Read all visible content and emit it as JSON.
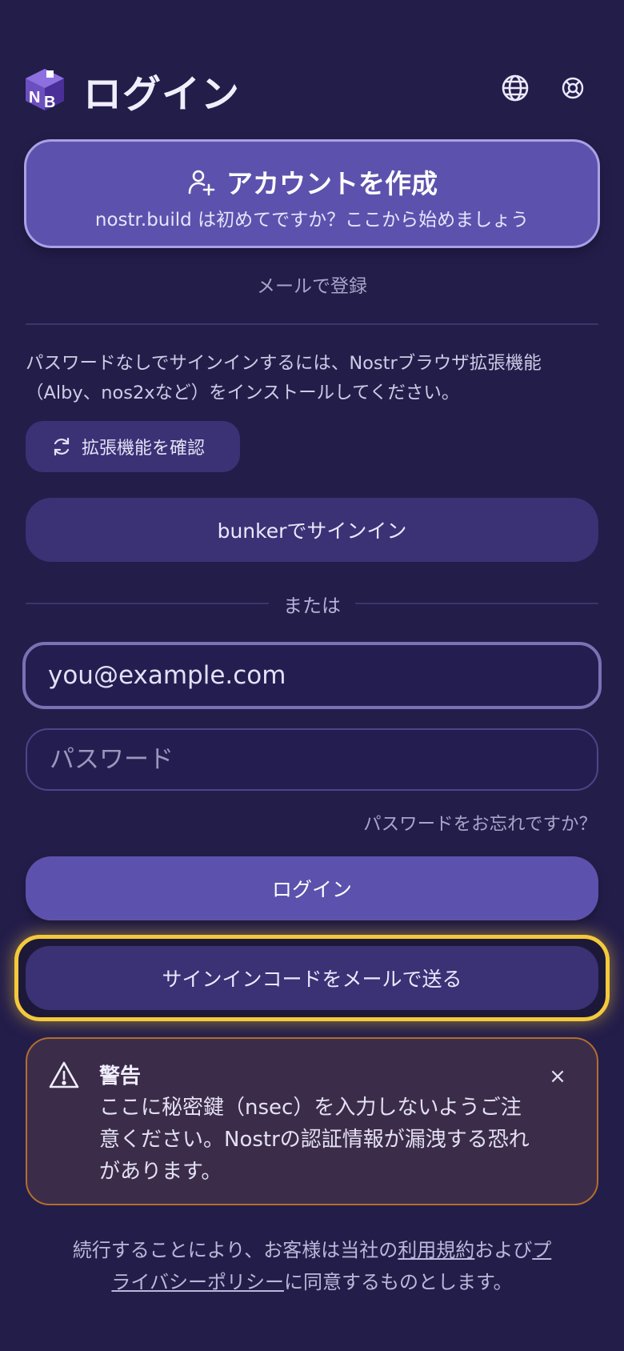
{
  "header": {
    "title": "ログイン",
    "logo_text": "NB"
  },
  "create_account": {
    "title": "アカウントを作成",
    "subtitle": "nostr.build は初めてですか？ここから始めましょう"
  },
  "email_register_label": "メールで登録",
  "extension_notice": "パスワードなしでサインインするには、Nostrブラウザ拡張機能（Alby、nos2xなど）をインストールしてください。",
  "check_extension_label": "拡張機能を確認",
  "bunker_label": "bunkerでサインイン",
  "or_label": "または",
  "form": {
    "email_value": "you@example.com",
    "password_placeholder": "パスワード",
    "forgot_label": "パスワードをお忘れですか？",
    "login_label": "ログイン",
    "send_code_label": "サインインコードをメールで送る"
  },
  "warning": {
    "title": "警告",
    "body": "ここに秘密鍵（nsec）を入力しないようご注意ください。Nostrの認証情報が漏洩する恐れがあります。",
    "close_symbol": "×"
  },
  "footer": {
    "prefix": "続行することにより、お客様は当社の",
    "terms": "利用規約",
    "middle": "および",
    "privacy": "プライバシーポリシー",
    "suffix": "に同意するものとします。"
  },
  "colors": {
    "background": "#231d4a",
    "primary": "#5c52ad",
    "secondary": "#3a3275",
    "highlight": "#f4c93a",
    "warning_border": "#b26d2e"
  }
}
